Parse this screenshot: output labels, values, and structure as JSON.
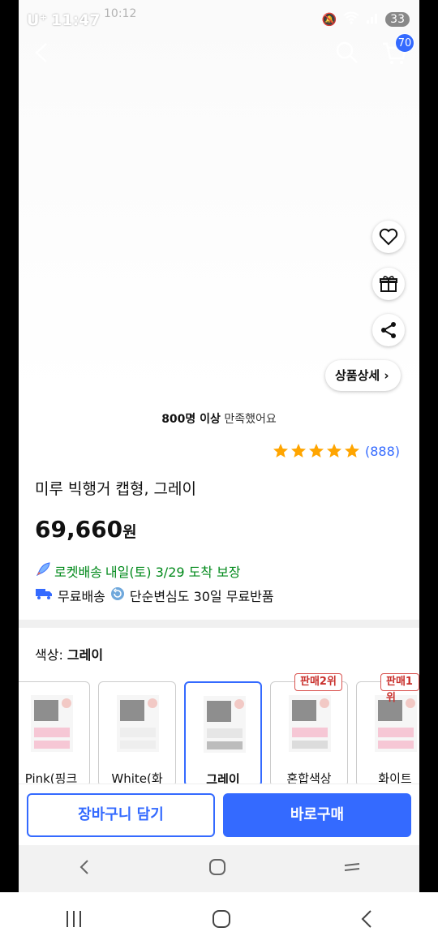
{
  "status_bar": {
    "carrier": "U⁺",
    "time": "11:47",
    "battery": "33",
    "faded_time": "10:12"
  },
  "header": {
    "cart_count": "70"
  },
  "side_actions": {
    "detail_label": "상품상세 ›"
  },
  "reviews": {
    "satisfied_bold": "800명 이상",
    "satisfied_rest": " 만족했어요",
    "rating": 5,
    "count": "(888)"
  },
  "product": {
    "title": "미루 빅행거 캡형, 그레이",
    "price": "69,660",
    "currency": "원"
  },
  "delivery": {
    "rocket_label": "로켓배송",
    "rocket_detail": "내일(토) 3/29 도착 보장",
    "free_shipping": "무료배송",
    "return_policy": "단순변심도 30일 무료반품"
  },
  "options": {
    "label_prefix": "색상: ",
    "selected_name": "그레이",
    "items": [
      {
        "label": "Pink(핑크",
        "rank": ""
      },
      {
        "label": "White(화",
        "rank": ""
      },
      {
        "label": "그레이",
        "rank": ""
      },
      {
        "label": "혼합색상",
        "rank": "판매2위"
      },
      {
        "label": "화이트",
        "rank": "판매1위"
      }
    ]
  },
  "actions": {
    "add_to_cart": "장바구니 담기",
    "buy_now": "바로구매"
  },
  "colors": {
    "accent": "#346aff",
    "rocket_green": "#00891a",
    "star": "#ffa500"
  }
}
